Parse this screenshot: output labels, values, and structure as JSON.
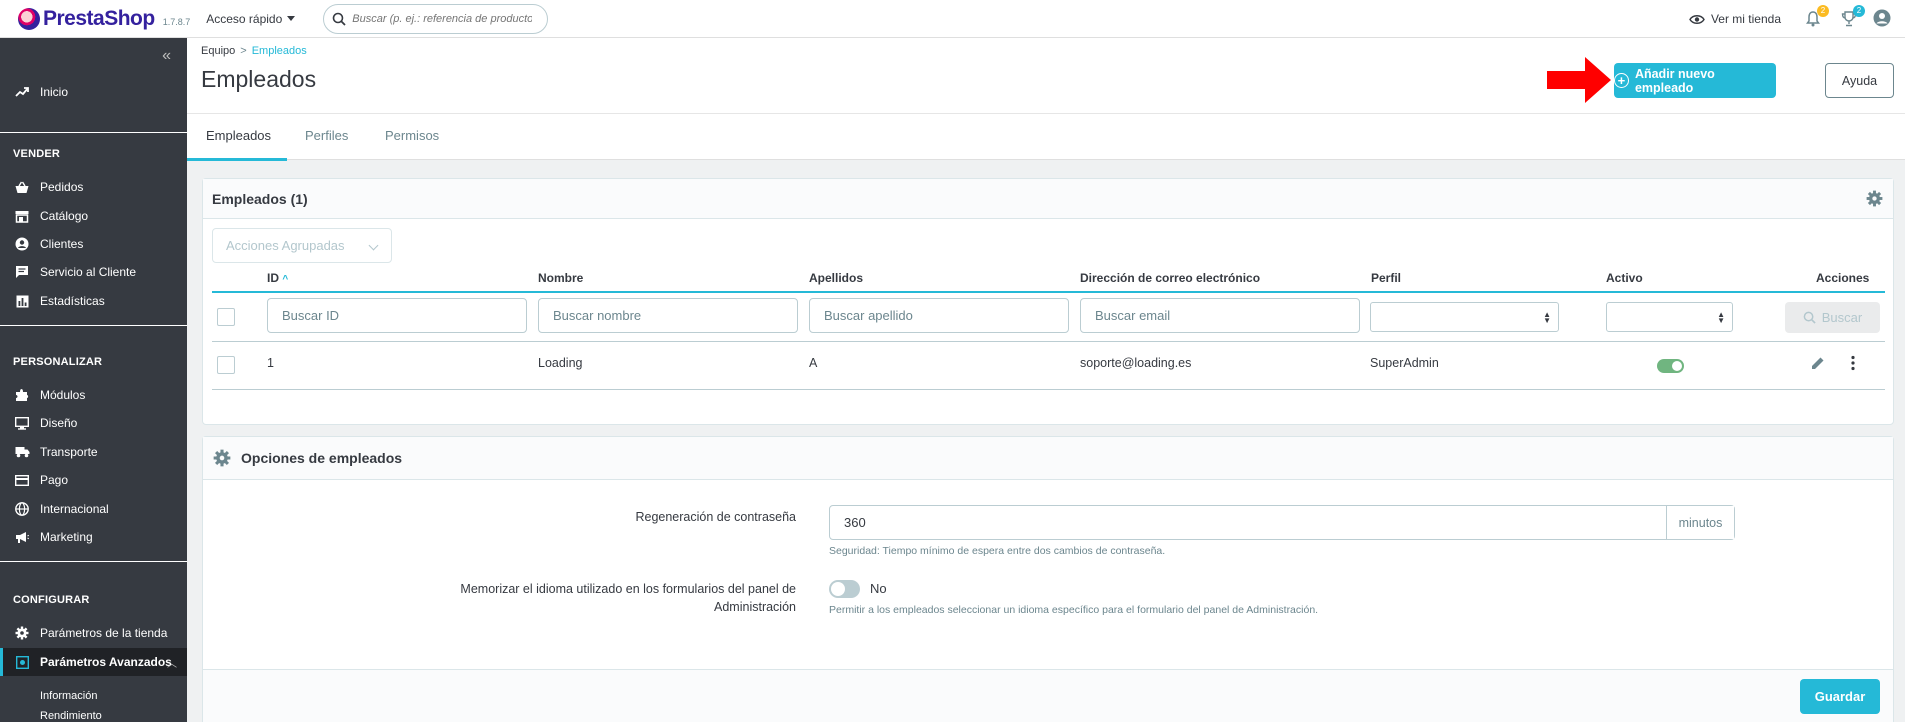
{
  "header": {
    "brand": "PrestaShop",
    "version": "1.7.8.7",
    "quick_access": "Acceso rápido",
    "search_placeholder": "Buscar (p. ej.: referencia de producto,",
    "view_store": "Ver mi tienda",
    "notifications_count": "2",
    "trophy_count": "2"
  },
  "sidebar": {
    "home": "Inicio",
    "sections": [
      {
        "title": "VENDER",
        "items": [
          "Pedidos",
          "Catálogo",
          "Clientes",
          "Servicio al Cliente",
          "Estadísticas"
        ]
      },
      {
        "title": "PERSONALIZAR",
        "items": [
          "Módulos",
          "Diseño",
          "Transporte",
          "Pago",
          "Internacional",
          "Marketing"
        ]
      },
      {
        "title": "CONFIGURAR",
        "items": [
          "Parámetros de la tienda",
          "Parámetros Avanzados"
        ]
      }
    ],
    "subitems": [
      "Información",
      "Rendimiento"
    ]
  },
  "page": {
    "breadcrumb": [
      "Equipo",
      "Empleados"
    ],
    "breadcrumb_sep": ">",
    "title": "Empleados",
    "add_button": "Añadir nuevo empleado",
    "help_button": "Ayuda",
    "tabs": [
      "Empleados",
      "Perfiles",
      "Permisos"
    ]
  },
  "employees_card": {
    "title": "Empleados (1)",
    "bulk_actions": "Acciones Agrupadas",
    "columns": [
      "ID",
      "Nombre",
      "Apellidos",
      "Dirección de correo electrónico",
      "Perfil",
      "Activo",
      "Acciones"
    ],
    "filters": {
      "id": "Buscar ID",
      "name": "Buscar nombre",
      "lastname": "Buscar apellido",
      "email": "Buscar email"
    },
    "search_button": "Buscar",
    "rows": [
      {
        "id": "1",
        "name": "Loading",
        "lastname": "A",
        "email": "soporte@loading.es",
        "profile": "SuperAdmin",
        "active": true
      }
    ]
  },
  "options_card": {
    "title": "Opciones de empleados",
    "password_label": "Regeneración de contraseña",
    "password_value": "360",
    "password_unit": "minutos",
    "password_help": "Seguridad: Tiempo mínimo de espera entre dos cambios de contraseña.",
    "language_label_1": "Memorizar el idioma utilizado en los formularios del panel de",
    "language_label_2": "Administración",
    "language_toggle": "No",
    "language_help": "Permitir a los empleados seleccionar un idioma específico para el formulario del panel de Administración.",
    "save_button": "Guardar"
  },
  "colors": {
    "accent": "#25b9d7",
    "sidebar": "#363a41",
    "arrow": "#ff0000",
    "active_toggle": "#70b580"
  }
}
